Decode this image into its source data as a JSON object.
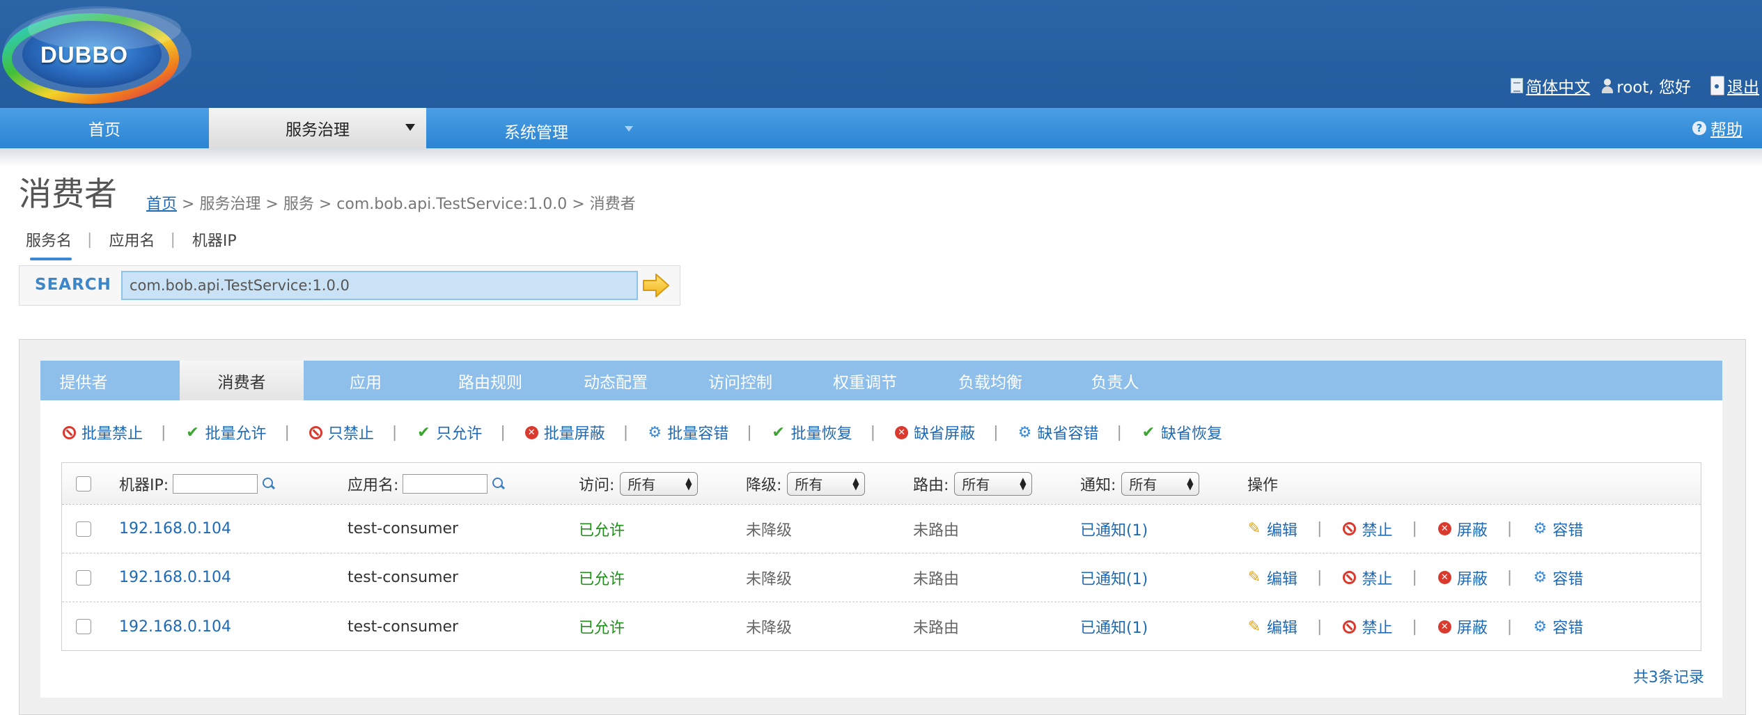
{
  "header": {
    "logo_text": "DUBBO",
    "language": "简体中文",
    "user_greeting": "root, 您好",
    "logout": "退出"
  },
  "nav": {
    "home": "首页",
    "governance": "服务治理",
    "system": "系统管理",
    "help": "帮助"
  },
  "page": {
    "title": "消费者",
    "breadcrumb": {
      "home": "首页",
      "rest": "> 服务治理 > 服务 > com.bob.api.TestService:1.0.0 > 消费者"
    }
  },
  "search": {
    "tabs": [
      "服务名",
      "应用名",
      "机器IP"
    ],
    "label": "SEARCH",
    "value": "com.bob.api.TestService:1.0.0"
  },
  "tabs": [
    "提供者",
    "消费者",
    "应用",
    "路由规则",
    "动态配置",
    "访问控制",
    "权重调节",
    "负载均衡",
    "负责人"
  ],
  "toolbar": [
    {
      "label": "批量禁止",
      "icon": "forbid-icon"
    },
    {
      "label": "批量允许",
      "icon": "check-icon"
    },
    {
      "label": "只禁止",
      "icon": "forbid-icon"
    },
    {
      "label": "只允许",
      "icon": "check-icon"
    },
    {
      "label": "批量屏蔽",
      "icon": "close-circle-icon"
    },
    {
      "label": "批量容错",
      "icon": "gear-icon"
    },
    {
      "label": "批量恢复",
      "icon": "check-icon"
    },
    {
      "label": "缺省屏蔽",
      "icon": "close-circle-icon"
    },
    {
      "label": "缺省容错",
      "icon": "gear-icon"
    },
    {
      "label": "缺省恢复",
      "icon": "check-icon"
    }
  ],
  "table": {
    "headers": {
      "ip": "机器IP:",
      "app": "应用名:",
      "access": "访问:",
      "degrade": "降级:",
      "route": "路由:",
      "notify": "通知:",
      "ops": "操作"
    },
    "filter_default": "所有",
    "rows": [
      {
        "ip": "192.168.0.104",
        "app": "test-consumer",
        "access": "已允许",
        "degrade": "未降级",
        "route": "未路由",
        "notify": "已通知(1)"
      },
      {
        "ip": "192.168.0.104",
        "app": "test-consumer",
        "access": "已允许",
        "degrade": "未降级",
        "route": "未路由",
        "notify": "已通知(1)"
      },
      {
        "ip": "192.168.0.104",
        "app": "test-consumer",
        "access": "已允许",
        "degrade": "未降级",
        "route": "未路由",
        "notify": "已通知(1)"
      }
    ],
    "row_ops": [
      "编辑",
      "禁止",
      "屏蔽",
      "容错"
    ]
  },
  "footer": {
    "count": "共3条记录"
  },
  "colors": {
    "header_bg": "#2b65a6",
    "nav_bg": "#3a8fdc",
    "tab_bg": "#8ebeea",
    "link": "#1f6ab4",
    "allowed_green": "#1f8f1a"
  }
}
